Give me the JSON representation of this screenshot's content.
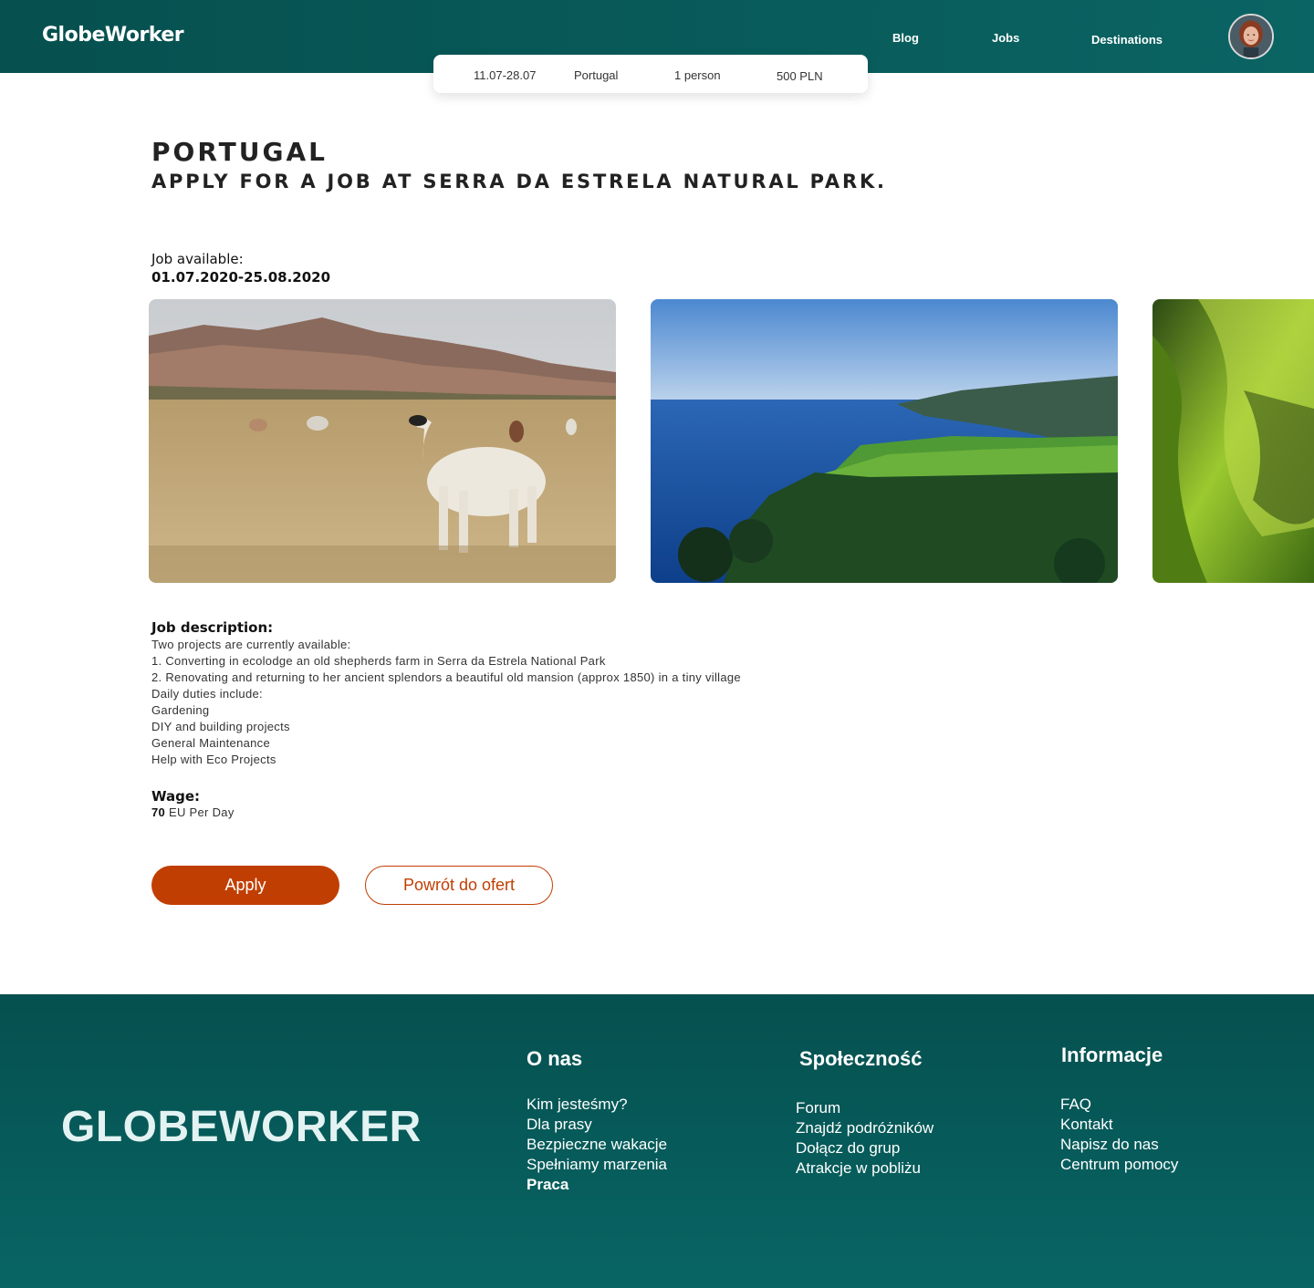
{
  "header": {
    "logo": "GlobeWorker",
    "nav": [
      "Blog",
      "Jobs",
      "Destinations"
    ]
  },
  "search": {
    "dates": "11.07-28.07",
    "destination": "Portugal",
    "people": "1 person",
    "budget": "500 PLN"
  },
  "page": {
    "title": "PORTUGAL",
    "subtitle": "APPLY FOR A JOB AT SERRA DA ESTRELA NATURAL PARK.",
    "availability_label": "Job available:",
    "availability_dates": "01.07.2020-25.08.2020"
  },
  "description": {
    "title": "Job description:",
    "lines": [
      "Two projects are currently available:",
      "1. Converting in ecolodge an old shepherds farm in Serra da Estrela National Park",
      "2. Renovating and returning to her ancient splendors a beautiful old mansion (approx 1850) in a tiny village",
      "Daily duties include:",
      "Gardening",
      "DIY and building projects",
      "General Maintenance",
      "Help with Eco Projects"
    ]
  },
  "wage": {
    "title": "Wage:",
    "amount": "70",
    "unit": "EU Per Day"
  },
  "buttons": {
    "apply": "Apply",
    "back": "Powrót do ofert"
  },
  "footer": {
    "logo": "GLOBEWORKER",
    "columns": [
      {
        "title": "O nas",
        "links": [
          "Kim jesteśmy?",
          "Dla prasy",
          "Bezpieczne wakacje",
          "Spełniamy marzenia",
          "Praca"
        ]
      },
      {
        "title": "Społeczność",
        "links": [
          "Forum",
          "Znajdź podróżników",
          "Dołącz do grup",
          "Atrakcje w pobliżu"
        ]
      },
      {
        "title": "Informacje",
        "links": [
          "FAQ",
          "Kontakt",
          "Napisz do nas",
          "Centrum pomocy"
        ]
      }
    ]
  },
  "colors": {
    "brand_teal": "#06504f",
    "accent_orange": "#c13e02"
  }
}
